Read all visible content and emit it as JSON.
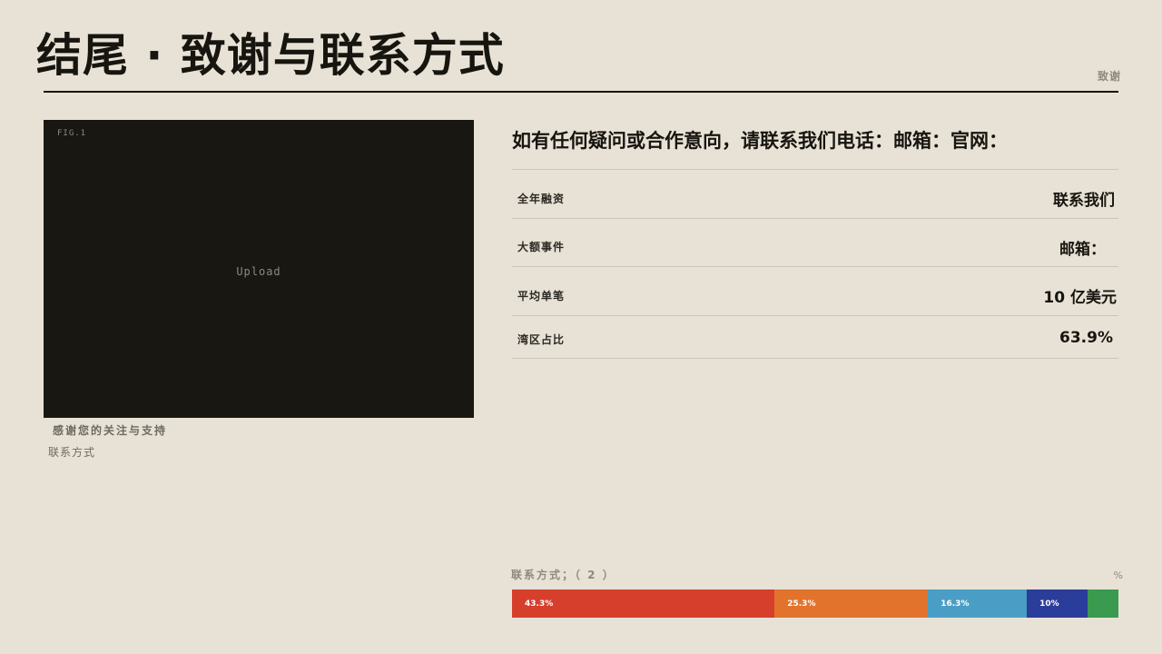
{
  "header": {
    "title": "结尾 · 致谢与联系方式",
    "tag": "致谢"
  },
  "figure": {
    "label": "FIG.1",
    "placeholder": "Upload",
    "caption": "感谢您的关注与支持",
    "subcaption": "联系方式"
  },
  "info": {
    "headline": "如有任何疑问或合作意向，请联系我们电话：邮箱：官网：",
    "stats": [
      {
        "label": "全年融资",
        "value": "联系我们"
      },
      {
        "label": "大额事件",
        "value": "邮箱："
      },
      {
        "label": "平均单笔",
        "value": "10 亿美元"
      },
      {
        "label": "湾区占比",
        "value": "63.9%"
      }
    ]
  },
  "breakdown": {
    "label": "联系方式；（ 2 ）",
    "unit": "%",
    "segments": [
      {
        "value": 43.3,
        "text": "43.3%",
        "color": "#d63f2c"
      },
      {
        "value": 25.3,
        "text": "25.3%",
        "color": "#e2732d"
      },
      {
        "value": 16.3,
        "text": "16.3%",
        "color": "#4a9ec5"
      },
      {
        "value": 10,
        "text": "10%",
        "color": "#2a3d9a"
      },
      {
        "value": 5.1,
        "text": "",
        "color": "#3a9a50"
      }
    ]
  }
}
